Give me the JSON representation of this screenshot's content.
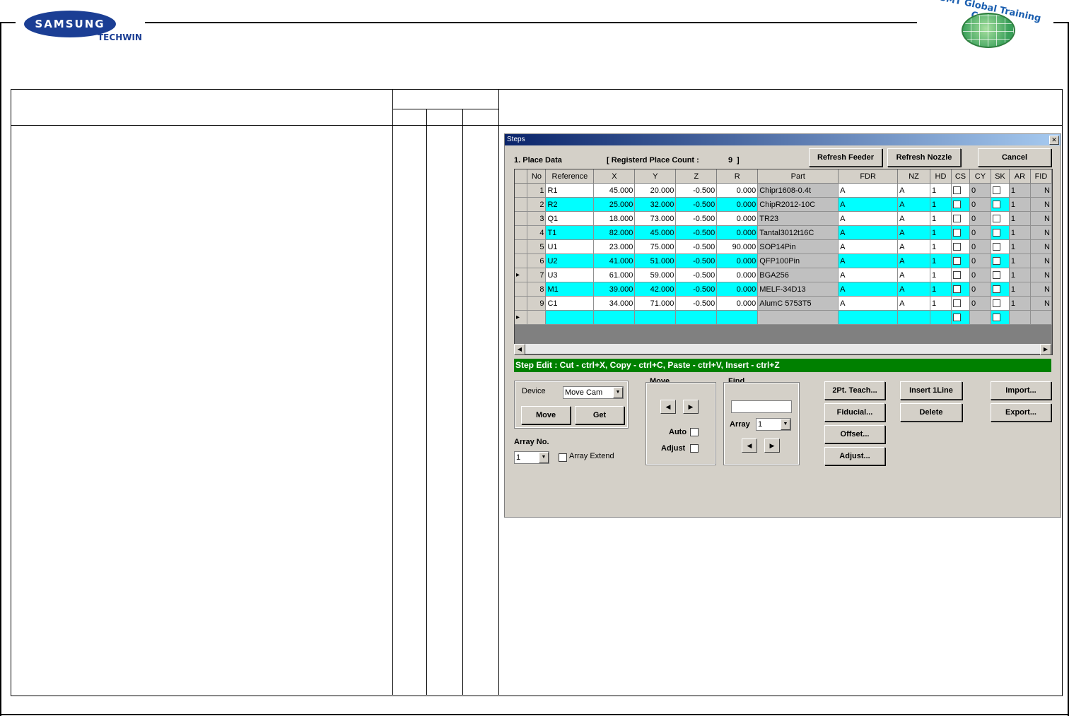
{
  "header": {
    "logo_main": "SAMSUNG",
    "logo_sub": "TECHWIN",
    "training_logo_text": "SMT Global Training Center"
  },
  "window": {
    "title": "Steps",
    "close_glyph": "✕",
    "place_data_label": "1. Place Data",
    "registered_label": "[ Registerd Place Count :",
    "registered_count": "9",
    "registered_close": "]",
    "buttons": {
      "refresh_feeder": "Refresh Feeder",
      "refresh_nozzle": "Refresh Nozzle",
      "cancel": "Cancel"
    },
    "grid": {
      "columns": [
        "No",
        "Reference",
        "X",
        "Y",
        "Z",
        "R",
        "Part",
        "FDR",
        "NZ",
        "HD",
        "CS",
        "CY",
        "SK",
        "AR",
        "FID"
      ],
      "rows": [
        {
          "no": "1",
          "ref": "R1",
          "x": "45.000",
          "y": "20.000",
          "z": "-0.500",
          "r": "0.000",
          "part": "Chipr1608-0.4t",
          "fdr": "A",
          "nz": "A",
          "hd": "1",
          "cy": "0",
          "ar": "1",
          "fid": "N",
          "hl": false
        },
        {
          "no": "2",
          "ref": "R2",
          "x": "25.000",
          "y": "32.000",
          "z": "-0.500",
          "r": "0.000",
          "part": "ChipR2012-10C",
          "fdr": "A",
          "nz": "A",
          "hd": "1",
          "cy": "0",
          "ar": "1",
          "fid": "N",
          "hl": true
        },
        {
          "no": "3",
          "ref": "Q1",
          "x": "18.000",
          "y": "73.000",
          "z": "-0.500",
          "r": "0.000",
          "part": "TR23",
          "fdr": "A",
          "nz": "A",
          "hd": "1",
          "cy": "0",
          "ar": "1",
          "fid": "N",
          "hl": false
        },
        {
          "no": "4",
          "ref": "T1",
          "x": "82.000",
          "y": "45.000",
          "z": "-0.500",
          "r": "0.000",
          "part": "Tantal3012t16C",
          "fdr": "A",
          "nz": "A",
          "hd": "1",
          "cy": "0",
          "ar": "1",
          "fid": "N",
          "hl": true
        },
        {
          "no": "5",
          "ref": "U1",
          "x": "23.000",
          "y": "75.000",
          "z": "-0.500",
          "r": "90.000",
          "part": "SOP14Pin",
          "fdr": "A",
          "nz": "A",
          "hd": "1",
          "cy": "0",
          "ar": "1",
          "fid": "N",
          "hl": false
        },
        {
          "no": "6",
          "ref": "U2",
          "x": "41.000",
          "y": "51.000",
          "z": "-0.500",
          "r": "0.000",
          "part": "QFP100Pin",
          "fdr": "A",
          "nz": "A",
          "hd": "1",
          "cy": "0",
          "ar": "1",
          "fid": "N",
          "hl": true
        },
        {
          "no": "7",
          "ref": "U3",
          "x": "61.000",
          "y": "59.000",
          "z": "-0.500",
          "r": "0.000",
          "part": "BGA256",
          "fdr": "A",
          "nz": "A",
          "hd": "1",
          "cy": "0",
          "ar": "1",
          "fid": "N",
          "hl": false
        },
        {
          "no": "8",
          "ref": "M1",
          "x": "39.000",
          "y": "42.000",
          "z": "-0.500",
          "r": "0.000",
          "part": "MELF-34D13",
          "fdr": "A",
          "nz": "A",
          "hd": "1",
          "cy": "0",
          "ar": "1",
          "fid": "N",
          "hl": true
        },
        {
          "no": "9",
          "ref": "C1",
          "x": "34.000",
          "y": "71.000",
          "z": "-0.500",
          "r": "0.000",
          "part": "AlumC 5753T5",
          "fdr": "A",
          "nz": "A",
          "hd": "1",
          "cy": "0",
          "ar": "1",
          "fid": "N",
          "hl": false
        }
      ]
    },
    "step_edit_text": "Step Edit : Cut - ctrl+X,  Copy - ctrl+C,  Paste - ctrl+V,      Insert - ctrl+Z",
    "device_label": "Device",
    "device_value": "Move Cam",
    "move_button": "Move",
    "get_button": "Get",
    "array_no_label": "Array No.",
    "array_no_value": "1",
    "array_extend_label": "Array Extend",
    "move_group_label": "Move",
    "auto_label": "Auto",
    "adjust_check_label": "Adjust",
    "find_group_label": "Find",
    "find_array_label": "Array",
    "find_array_value": "1",
    "right_buttons": {
      "teach": "2Pt. Teach...",
      "fiducial": "Fiducial...",
      "offset": "Offset...",
      "adjust": "Adjust...",
      "insert_line": "Insert 1Line",
      "delete": "Delete",
      "import": "Import...",
      "export": "Export..."
    }
  }
}
